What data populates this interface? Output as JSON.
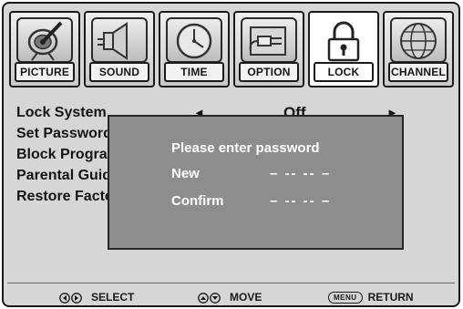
{
  "tabs": [
    {
      "label": "PICTURE",
      "icon": "satellite-dish-icon",
      "active": false
    },
    {
      "label": "SOUND",
      "icon": "speaker-icon",
      "active": false
    },
    {
      "label": "TIME",
      "icon": "clock-icon",
      "active": false
    },
    {
      "label": "OPTION",
      "icon": "plug-icon",
      "active": false
    },
    {
      "label": "LOCK",
      "icon": "padlock-icon",
      "active": true
    },
    {
      "label": "CHANNEL",
      "icon": "globe-icon",
      "active": false
    }
  ],
  "menu": {
    "items": [
      {
        "label": "Lock System"
      },
      {
        "label": "Set Password"
      },
      {
        "label": "Block Program"
      },
      {
        "label": "Parental Guidance"
      },
      {
        "label": "Restore Factory Default"
      }
    ],
    "lock_system_value": "Off",
    "left_arrow": "◄",
    "right_arrow": "►"
  },
  "dialog": {
    "title": "Please enter password",
    "new_label": "New",
    "new_value": "– -- -- –",
    "confirm_label": "Confirm",
    "confirm_value": "– -- -- –"
  },
  "footer": {
    "select_label": "SELECT",
    "move_label": "MOVE",
    "menu_key": "MENU",
    "return_label": "RETURN"
  },
  "colors": {
    "background": "#d6d6d6",
    "dialog_background": "#8d8d8d",
    "text": "#141414",
    "dialog_text": "#ffffff"
  }
}
